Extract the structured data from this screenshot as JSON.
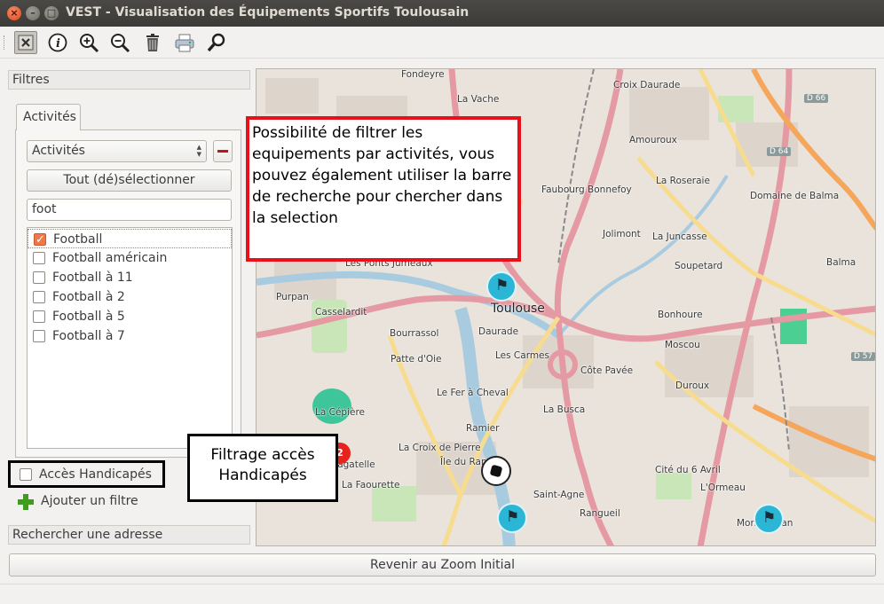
{
  "window": {
    "title": "VEST - Visualisation des Équipements Sportifs Toulousain",
    "close_glyph": "×",
    "min_glyph": "–",
    "max_glyph": "□"
  },
  "toolbar": {
    "items": [
      "close-tool",
      "info",
      "zoom-in",
      "zoom-out",
      "delete",
      "print",
      "search"
    ]
  },
  "filters": {
    "header": "Filtres",
    "tab_label": "Activités",
    "combo_value": "Activités",
    "toggle_all_label": "Tout (dé)sélectionner",
    "search_value": "foot",
    "items": [
      {
        "label": "Football",
        "checked": true
      },
      {
        "label": "Football américain",
        "checked": false
      },
      {
        "label": "Football à 11",
        "checked": false
      },
      {
        "label": "Football à 2",
        "checked": false
      },
      {
        "label": "Football à 5",
        "checked": false
      },
      {
        "label": "Football à 7",
        "checked": false
      }
    ],
    "handicap_label": "Accès Handicapés",
    "add_filter_label": "Ajouter un filtre"
  },
  "address_search": {
    "header": "Rechercher une adresse"
  },
  "reset_zoom_label": "Revenir au Zoom Initial",
  "annotations": {
    "activity_note": "Possibilité de filtrer les equipements par activités, vous pouvez également utiliser la barre de recherche pour chercher dans la selection",
    "handicap_note": "Filtrage accès Handicapés"
  },
  "map": {
    "places": [
      "Fondeyre",
      "La Vache",
      "Croix Daurade",
      "Amouroux",
      "Faubourg Bonnefoy",
      "La Roseraie",
      "Domaine de Balma",
      "Jolimont",
      "La Juncasse",
      "Balma",
      "Les Ponts Jumeaux",
      "Toulouse",
      "Soupetard",
      "Purpan",
      "Casselardit",
      "Bonhoure",
      "Bourrassol",
      "Daurade",
      "Moscou",
      "Patte d'Oie",
      "Les Carmes",
      "Côte Pavée",
      "Duroux",
      "Le Fer à Cheval",
      "La Cépière",
      "La Busca",
      "Ramier",
      "La Croix de Pierre",
      "Île du Ramier",
      "Cité du 6 Avril",
      "Saint-Agne",
      "L'Ormeau",
      "La Faourette",
      "Rangueil",
      "Montaudran",
      "Bagatelle"
    ],
    "roads": [
      "D 66",
      "D 64",
      "D 57"
    ],
    "cluster_count": "2"
  }
}
